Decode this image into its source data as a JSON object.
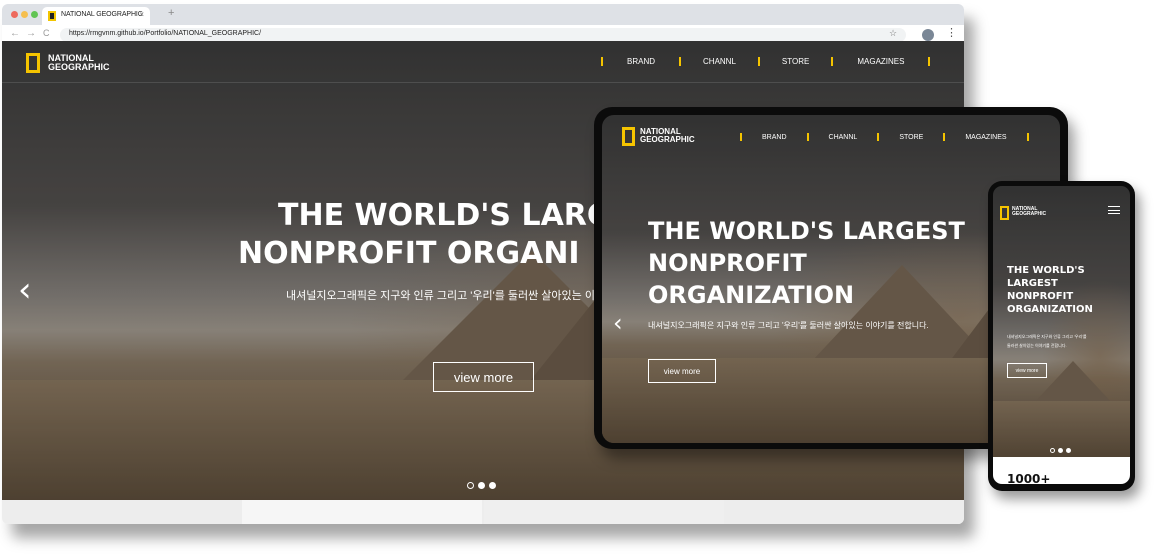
{
  "browser": {
    "tab_title": "NATIONAL GEOGRAPHIC",
    "tab_close": "×",
    "new_tab": "+",
    "url": "https://rmgvnm.github.io/Portfolio/NATIONAL_GEOGRAPHIC/",
    "back": "←",
    "forward": "→",
    "reload": "C",
    "bookmark": "☆",
    "menu": "⋮",
    "traffic_light_colors": [
      "#ed6a5e",
      "#f5bf4f",
      "#61c454"
    ]
  },
  "site": {
    "logo_line1": "NATIONAL",
    "logo_line2": "GEOGRAPHIC",
    "nav": [
      "BRAND",
      "CHANNL",
      "STORE",
      "MAGAZINES"
    ],
    "accent": "#f5c400"
  },
  "desktop": {
    "title_line1": "THE WORLD'S LARG",
    "title_line2": "NONPROFIT ORGANI",
    "subtitle": "내셔널지오그래픽은 지구와 인류 그리고 '우리'를 둘러싼 살아있는 이",
    "button": "view more",
    "prev_arrow": "‹"
  },
  "tablet": {
    "title_line1": "THE WORLD'S LARGEST",
    "title_line2": "NONPROFIT",
    "title_line3": "ORGANIZATION",
    "subtitle": "내셔널지오그래픽은 지구와 인류 그리고 '우리'를 둘러싼 살아있는 이야기를 전합니다.",
    "button": "view more",
    "prev_arrow": "‹"
  },
  "phone": {
    "title_line1": "THE WORLD'S",
    "title_line2": "LARGEST",
    "title_line3": "NONPROFIT",
    "title_line4": "ORGANIZATION",
    "subtitle_line1": "내셔널지오그래픽은 지구와 인류 그리고 '우리'를",
    "subtitle_line2": "둘러싼 살아있는 이야기를 전합니다.",
    "button": "view more",
    "stat": "1000+"
  }
}
